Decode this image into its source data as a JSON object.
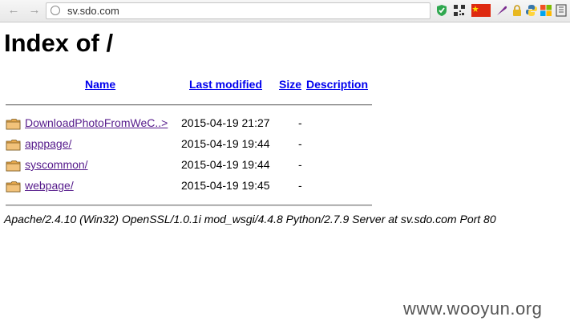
{
  "browser": {
    "url": "sv.sdo.com"
  },
  "page": {
    "title": "Index of /",
    "columns": {
      "name": "Name",
      "last_modified": "Last modified",
      "size": "Size",
      "description": "Description"
    },
    "entries": [
      {
        "name": "DownloadPhotoFromWeC..>",
        "date": "2015-04-19 21:27",
        "size": "-"
      },
      {
        "name": "apppage/",
        "date": "2015-04-19 19:44",
        "size": "-"
      },
      {
        "name": "syscommon/",
        "date": "2015-04-19 19:44",
        "size": "-"
      },
      {
        "name": "webpage/",
        "date": "2015-04-19 19:45",
        "size": "-"
      }
    ],
    "server_signature": "Apache/2.4.10 (Win32) OpenSSL/1.0.1i mod_wsgi/4.4.8 Python/2.7.9 Server at sv.sdo.com Port 80"
  },
  "watermark": "www.wooyun.org"
}
